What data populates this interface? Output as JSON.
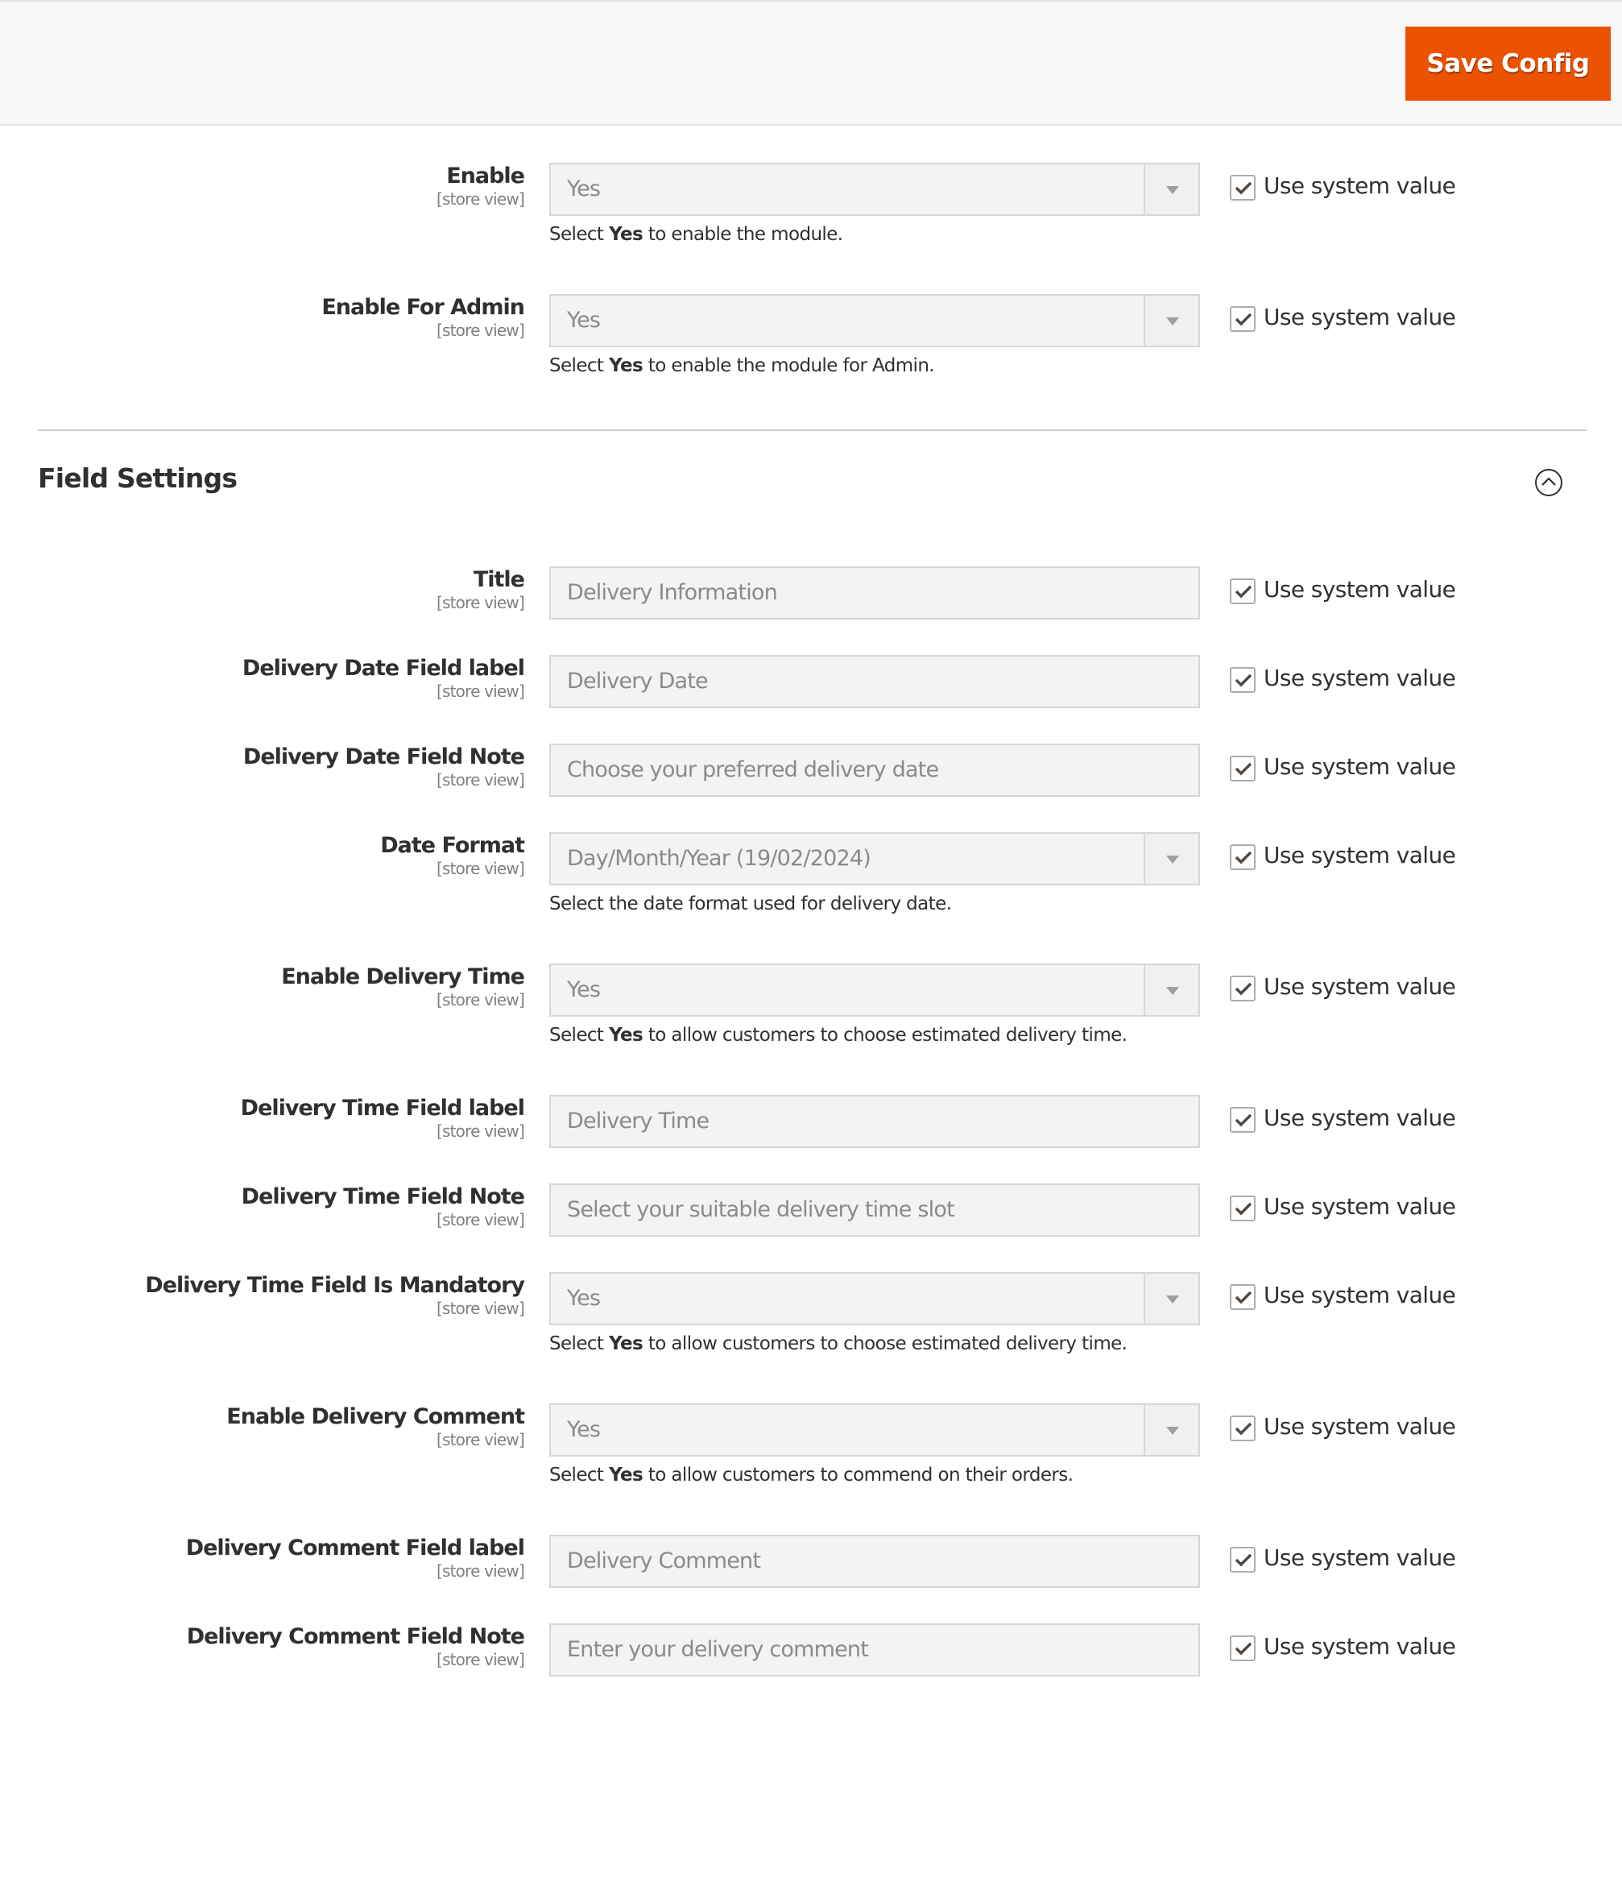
{
  "header": {
    "save_button_label": "Save Config",
    "accent_color": "#eb5202"
  },
  "general": {
    "fields": [
      {
        "label": "Enable",
        "scope": "[store view]",
        "type": "select",
        "value": "Yes",
        "note_prefix": "Select ",
        "note_bold": "Yes",
        "note_suffix": " to enable the module.",
        "use_system_value": true,
        "use_system_value_label": "Use system value"
      },
      {
        "label": "Enable For Admin",
        "scope": "[store view]",
        "type": "select",
        "value": "Yes",
        "note_prefix": "Select ",
        "note_bold": "Yes",
        "note_suffix": " to enable the module for Admin.",
        "use_system_value": true,
        "use_system_value_label": "Use system value"
      }
    ]
  },
  "field_settings": {
    "title": "Field Settings",
    "collapse_icon": "chevron-up-circle-icon",
    "fields": [
      {
        "label": "Title",
        "scope": "[store view]",
        "type": "text",
        "value": "Delivery Information",
        "use_system_value": true,
        "use_system_value_label": "Use system value"
      },
      {
        "label": "Delivery Date Field label",
        "scope": "[store view]",
        "type": "text",
        "value": "Delivery Date",
        "use_system_value": true,
        "use_system_value_label": "Use system value"
      },
      {
        "label": "Delivery Date Field Note",
        "scope": "[store view]",
        "type": "text",
        "value": "Choose your preferred delivery date",
        "use_system_value": true,
        "use_system_value_label": "Use system value"
      },
      {
        "label": "Date Format",
        "scope": "[store view]",
        "type": "select",
        "value": "Day/Month/Year (19/02/2024)",
        "note_prefix": "Select the date format used for delivery date.",
        "note_bold": "",
        "note_suffix": "",
        "use_system_value": true,
        "use_system_value_label": "Use system value"
      },
      {
        "label": "Enable Delivery Time",
        "scope": "[store view]",
        "type": "select",
        "value": "Yes",
        "note_prefix": "Select ",
        "note_bold": "Yes",
        "note_suffix": " to allow customers to choose estimated delivery time.",
        "use_system_value": true,
        "use_system_value_label": "Use system value"
      },
      {
        "label": "Delivery Time Field label",
        "scope": "[store view]",
        "type": "text",
        "value": "Delivery Time",
        "use_system_value": true,
        "use_system_value_label": "Use system value"
      },
      {
        "label": "Delivery Time Field Note",
        "scope": "[store view]",
        "type": "text",
        "value": "Select your suitable delivery time slot",
        "use_system_value": true,
        "use_system_value_label": "Use system value"
      },
      {
        "label": "Delivery Time Field Is Mandatory",
        "scope": "[store view]",
        "type": "select",
        "value": "Yes",
        "note_prefix": "Select ",
        "note_bold": "Yes",
        "note_suffix": " to allow customers to choose estimated delivery time.",
        "use_system_value": true,
        "use_system_value_label": "Use system value"
      },
      {
        "label": "Enable Delivery Comment",
        "scope": "[store view]",
        "type": "select",
        "value": "Yes",
        "note_prefix": "Select ",
        "note_bold": "Yes",
        "note_suffix": " to allow customers to commend on their orders.",
        "use_system_value": true,
        "use_system_value_label": "Use system value"
      },
      {
        "label": "Delivery Comment Field label",
        "scope": "[store view]",
        "type": "text",
        "value": "Delivery Comment",
        "use_system_value": true,
        "use_system_value_label": "Use system value"
      },
      {
        "label": "Delivery Comment Field Note",
        "scope": "[store view]",
        "type": "text",
        "value": "Enter your delivery comment",
        "use_system_value": true,
        "use_system_value_label": "Use system value"
      }
    ]
  }
}
